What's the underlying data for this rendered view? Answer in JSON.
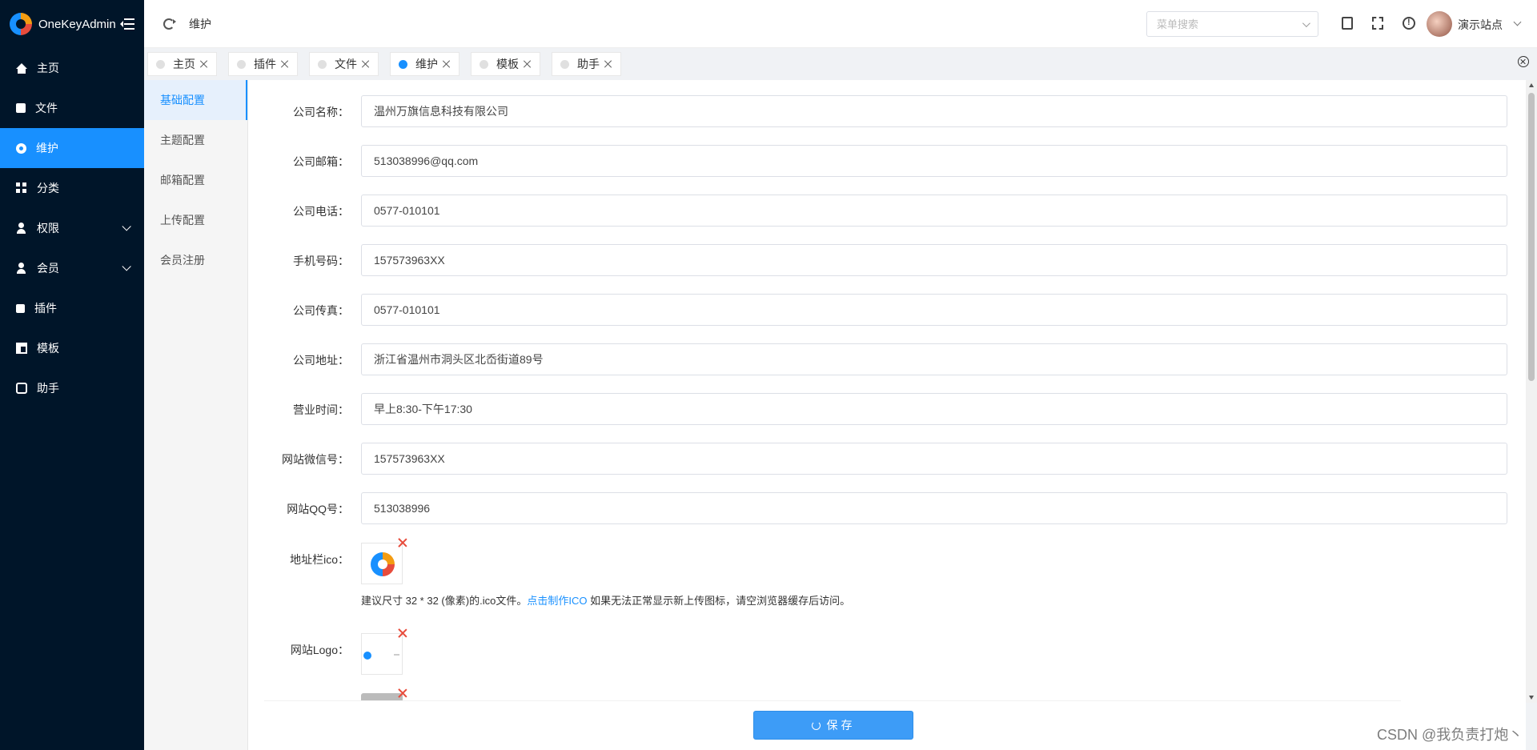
{
  "app": {
    "title": "OneKeyAdmin"
  },
  "sidebar": {
    "items": [
      {
        "label": "主页",
        "icon": "home-icon",
        "active": false,
        "expandable": false
      },
      {
        "label": "文件",
        "icon": "file-icon",
        "active": false,
        "expandable": false
      },
      {
        "label": "维护",
        "icon": "gear-icon",
        "active": true,
        "expandable": false
      },
      {
        "label": "分类",
        "icon": "grid-icon",
        "active": false,
        "expandable": false
      },
      {
        "label": "权限",
        "icon": "user-lock-icon",
        "active": false,
        "expandable": true
      },
      {
        "label": "会员",
        "icon": "user-icon",
        "active": false,
        "expandable": true
      },
      {
        "label": "插件",
        "icon": "puzzle-icon",
        "active": false,
        "expandable": false
      },
      {
        "label": "模板",
        "icon": "layout-icon",
        "active": false,
        "expandable": false
      },
      {
        "label": "助手",
        "icon": "robot-icon",
        "active": false,
        "expandable": false
      }
    ]
  },
  "header": {
    "breadcrumb": "维护",
    "menu_search_placeholder": "菜单搜索",
    "user_name": "演示站点"
  },
  "tabs": [
    {
      "label": "主页",
      "active": false
    },
    {
      "label": "插件",
      "active": false
    },
    {
      "label": "文件",
      "active": false
    },
    {
      "label": "维护",
      "active": true
    },
    {
      "label": "模板",
      "active": false
    },
    {
      "label": "助手",
      "active": false
    }
  ],
  "subnav": {
    "items": [
      {
        "label": "基础配置",
        "active": true
      },
      {
        "label": "主题配置",
        "active": false
      },
      {
        "label": "邮箱配置",
        "active": false
      },
      {
        "label": "上传配置",
        "active": false
      },
      {
        "label": "会员注册",
        "active": false
      }
    ]
  },
  "form": {
    "fields": [
      {
        "label": "公司名称：",
        "value": "温州万旗信息科技有限公司"
      },
      {
        "label": "公司邮箱：",
        "value": "513038996@qq.com"
      },
      {
        "label": "公司电话：",
        "value": "0577-010101"
      },
      {
        "label": "手机号码：",
        "value": "157573963XX"
      },
      {
        "label": "公司传真：",
        "value": "0577-010101"
      },
      {
        "label": "公司地址：",
        "value": "浙江省温州市洞头区北岙街道89号"
      },
      {
        "label": "营业时间：",
        "value": "早上8:30-下午17:30"
      },
      {
        "label": "网站微信号：",
        "value": "157573963XX"
      },
      {
        "label": "网站QQ号：",
        "value": "513038996"
      }
    ],
    "favicon_label": "地址栏ico：",
    "favicon_hint_prefix": "建议尺寸 32 * 32 (像素)的.ico文件。",
    "favicon_hint_link": "点击制作ICO",
    "favicon_hint_suffix": " 如果无法正常显示新上传图标，请空浏览器缓存后访问。",
    "logo_label": "网站Logo："
  },
  "footer": {
    "save_label": "保存"
  },
  "watermark": "CSDN @我负责打炮丶",
  "colors": {
    "sidebar_bg": "#001529",
    "accent": "#1890ff",
    "delete": "#e74c3c"
  }
}
